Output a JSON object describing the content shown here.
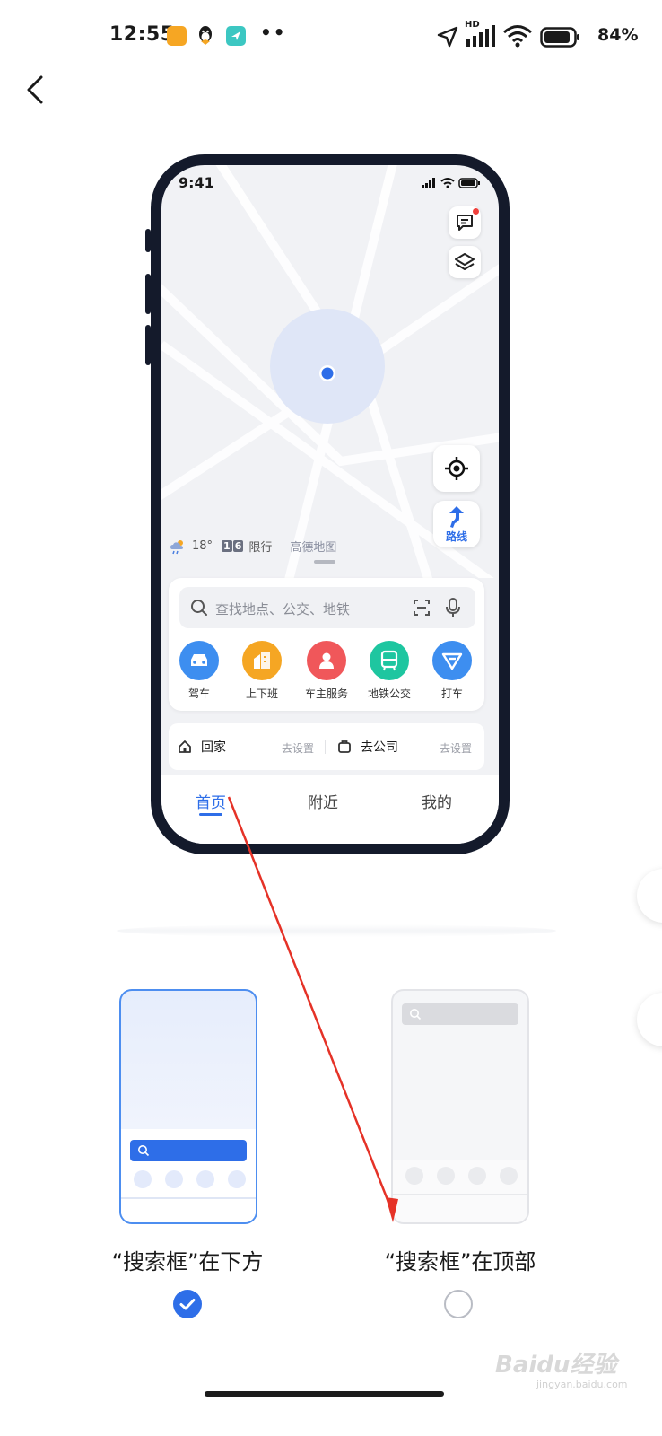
{
  "status_bar": {
    "time": "12:55",
    "network": "HD",
    "battery": "84%"
  },
  "phone": {
    "time": "9:41",
    "temperature": "18°",
    "restrict_badge_1": "1",
    "restrict_badge_2": "6",
    "restrict_label": "限行",
    "brand": "高德地图",
    "route_label": "路线",
    "search_placeholder": "查找地点、公交、地铁",
    "services": [
      {
        "label": "驾车",
        "color": "#3d8ef0"
      },
      {
        "label": "上下班",
        "color": "#f5a623"
      },
      {
        "label": "车主服务",
        "color": "#f0575a"
      },
      {
        "label": "地铁公交",
        "color": "#1ec6a0"
      },
      {
        "label": "打车",
        "color": "#3d8ef0"
      }
    ],
    "home_label": "回家",
    "home_set": "去设置",
    "work_label": "去公司",
    "work_set": "去设置",
    "tabs": [
      "首页",
      "附近",
      "我的"
    ]
  },
  "options": [
    {
      "label": "“搜索框”在下方",
      "selected": true
    },
    {
      "label": "“搜索框”在顶部",
      "selected": false
    }
  ],
  "watermark": {
    "main": "Baidu经验",
    "sub": "jingyan.baidu.com"
  },
  "colors": {
    "accent": "#2e6ee8",
    "annotation_arrow": "#e53227"
  }
}
